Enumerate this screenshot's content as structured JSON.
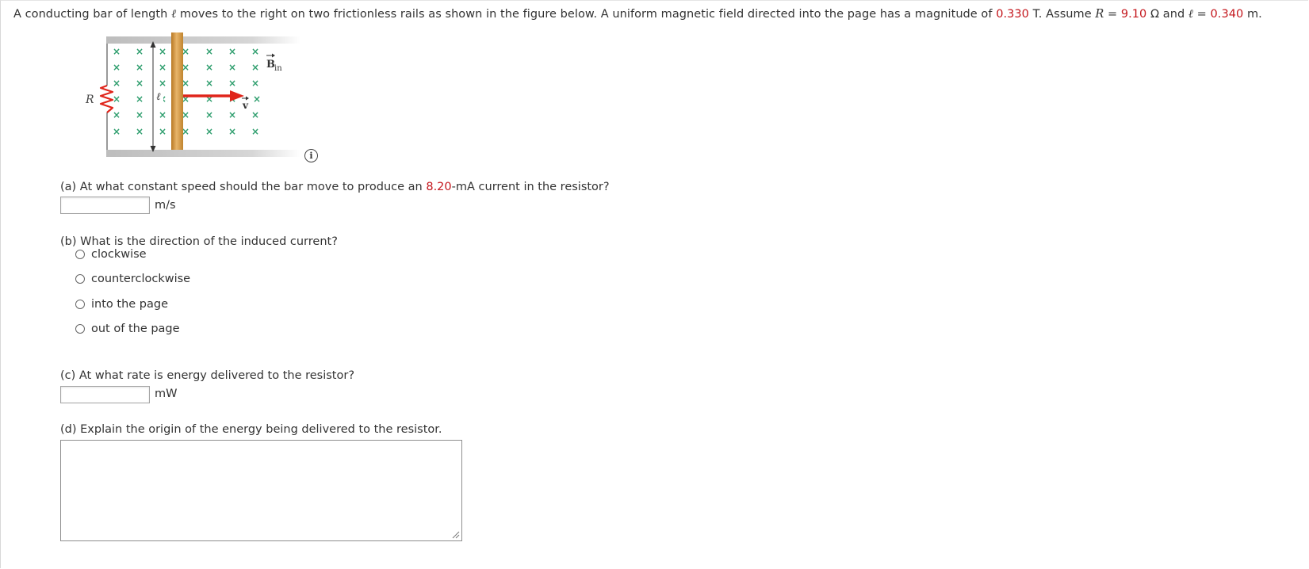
{
  "problem": {
    "intro_1": "A conducting bar of length ",
    "ell": "ℓ",
    "intro_2": " moves to the right on two frictionless rails as shown in the figure below. A uniform magnetic field directed into the page has a magnitude of ",
    "B_value": "0.330",
    "intro_3": " T. Assume ",
    "R_symbol": "R",
    "intro_4": " = ",
    "R_value": "9.10",
    "intro_5": " Ω and ",
    "intro_6": " = ",
    "l_value": "0.340",
    "intro_7": " m."
  },
  "figure": {
    "label_R": "R",
    "label_ell": "ℓ",
    "label_B": "B",
    "label_B_sub": "in",
    "label_v": "v",
    "field_symbol": "×",
    "colors": {
      "rail": "#c9c9c9",
      "bar": "#d19b48",
      "field": "#2f9e6e",
      "arrow": "#e0251b",
      "resistor": "#e0251b"
    }
  },
  "info_icon": {
    "glyph": "i",
    "name": "info-icon"
  },
  "part_a": {
    "prefix": "(a) At what constant speed should the bar move to produce an ",
    "value": "8.20",
    "suffix": "-mA current in the resistor?",
    "input_value": "",
    "unit": "m/s"
  },
  "part_b": {
    "question": "(b) What is the direction of the induced current?",
    "options": [
      "clockwise",
      "counterclockwise",
      "into the page",
      "out of the page"
    ]
  },
  "part_c": {
    "question": "(c) At what rate is energy delivered to the resistor?",
    "input_value": "",
    "unit": "mW"
  },
  "part_d": {
    "question": "(d) Explain the origin of the energy being delivered to the resistor.",
    "input_value": ""
  }
}
